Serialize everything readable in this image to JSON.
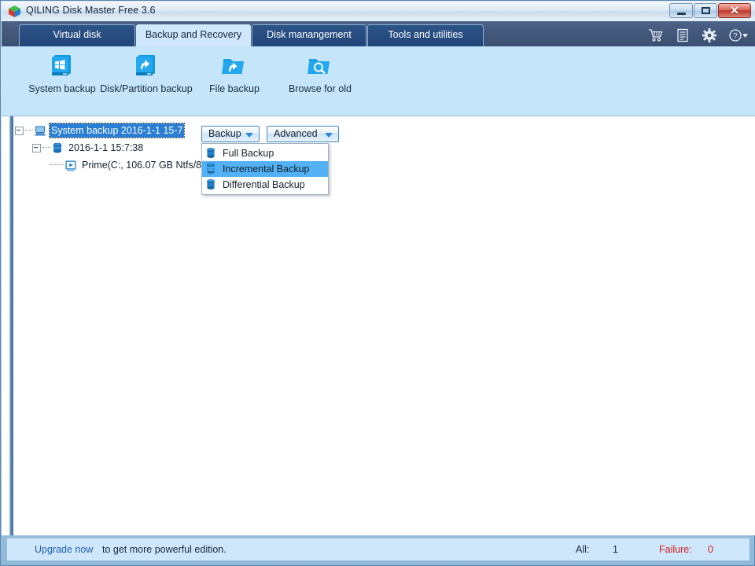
{
  "window": {
    "title": "QILING Disk Master Free 3.6",
    "app_icon": "cube-icon",
    "controls": {
      "minimize": "minimize-icon",
      "maximize": "maximize-icon",
      "close_glyph": "✕"
    }
  },
  "tabs": [
    {
      "label": "Virtual disk",
      "active": false
    },
    {
      "label": "Backup and Recovery",
      "active": true
    },
    {
      "label": "Disk manangement",
      "active": false
    },
    {
      "label": "Tools and utilities",
      "active": false
    }
  ],
  "tab_tools": [
    {
      "name": "cart-icon"
    },
    {
      "name": "list-icon"
    },
    {
      "name": "gear-icon"
    },
    {
      "name": "help-icon"
    }
  ],
  "toolbar": [
    {
      "label": "System backup",
      "icon": "system-backup-icon"
    },
    {
      "label": "Disk/Partition backup",
      "icon": "disk-partition-backup-icon"
    },
    {
      "label": "File backup",
      "icon": "file-backup-icon"
    },
    {
      "label": "Browse for old",
      "icon": "browse-for-old-icon"
    }
  ],
  "tree": {
    "root": {
      "label": "System backup 2016-1-1 15-7",
      "icon": "computer-icon",
      "selected": true
    },
    "child": {
      "label": "2016-1-1 15:7:38",
      "icon": "database-icon"
    },
    "grandchild": {
      "label": "Prime(C:, 106.07 GB Ntfs/8)",
      "icon": "partition-icon"
    }
  },
  "buttons": {
    "backup": "Backup",
    "advanced": "Advanced"
  },
  "menu": {
    "items": [
      {
        "label": "Full Backup",
        "icon": "database-icon",
        "selected": false
      },
      {
        "label": "Incremental Backup",
        "icon": "database-stack-icon",
        "selected": true
      },
      {
        "label": "Differential Backup",
        "icon": "database-icon",
        "selected": false
      }
    ]
  },
  "statusbar": {
    "upgrade_link": "Upgrade now",
    "upgrade_text": "to get more powerful edition.",
    "all_label": "All:",
    "all_value": "1",
    "failure_label": "Failure:",
    "failure_value": "0"
  },
  "colors": {
    "accent_blue": "#2f86d4",
    "toolbar_band": "#c5e5fb",
    "tab_active_bg": "#cfe8fb",
    "tab_inactive_bg": "#22457a",
    "selection_blue": "#2a7fd4",
    "menu_highlight": "#52b2f5",
    "failure_red": "#d02020",
    "link_blue": "#1f5fb0"
  }
}
